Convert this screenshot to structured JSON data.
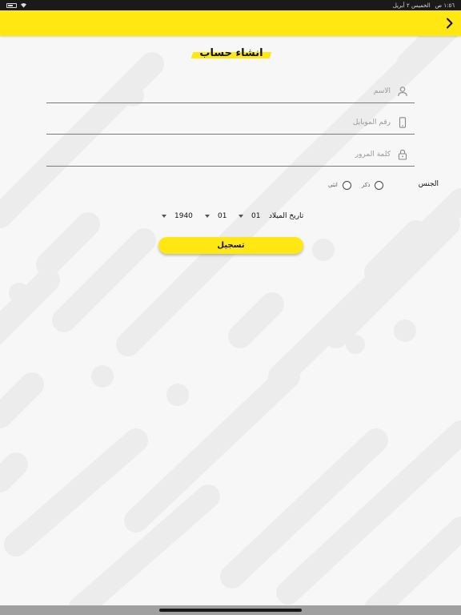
{
  "status_bar": {
    "time": "١:٥٦ ص",
    "date": "الخميس ٢ أبريل"
  },
  "header": {
    "back_icon": "chevron-right-icon",
    "accent": "#ffe812"
  },
  "page": {
    "title": "انشاء حساب"
  },
  "form": {
    "name": {
      "placeholder": "الاسم",
      "icon": "user-icon"
    },
    "mobile": {
      "placeholder": "رقم الموبايل",
      "icon": "phone-icon"
    },
    "password": {
      "placeholder": "كلمة المرور",
      "icon": "lock-icon"
    },
    "gender": {
      "label": "الجنس",
      "options": [
        "ذكر",
        "انثى"
      ]
    },
    "dob": {
      "label": "تاريخ الميلاد",
      "day": "01",
      "month": "01",
      "year": "1940"
    },
    "submit_label": "تسجيل"
  }
}
